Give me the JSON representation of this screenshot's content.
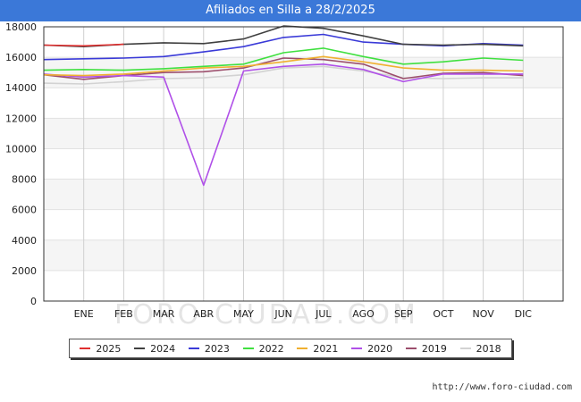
{
  "page": {
    "title": "Afiliados en Silla a 28/2/2025",
    "url": "http://www.foro-ciudad.com",
    "watermark": "FORO-CIUDAD.COM"
  },
  "chart_data": {
    "type": "line",
    "title": "Afiliados en Silla a 28/2/2025",
    "categories": [
      "",
      "ENE",
      "FEB",
      "MAR",
      "ABR",
      "MAY",
      "JUN",
      "JUL",
      "AGO",
      "SEP",
      "OCT",
      "NOV",
      "DIC"
    ],
    "ylim": [
      0,
      18000
    ],
    "yticks": [
      0,
      2000,
      4000,
      6000,
      8000,
      10000,
      12000,
      14000,
      16000,
      18000
    ],
    "grid": true,
    "legend_position": "bottom",
    "series": [
      {
        "name": "2025",
        "color": "#e03030",
        "values": [
          16800,
          16750,
          16850
        ]
      },
      {
        "name": "2024",
        "color": "#404040",
        "values": [
          16800,
          16700,
          16850,
          16950,
          16900,
          17200,
          18050,
          17900,
          17400,
          16850,
          16800,
          16850,
          16750
        ]
      },
      {
        "name": "2023",
        "color": "#3a3ad8",
        "values": [
          15850,
          15900,
          15950,
          16050,
          16350,
          16700,
          17300,
          17500,
          17000,
          16850,
          16750,
          16900,
          16800
        ]
      },
      {
        "name": "2022",
        "color": "#40e040",
        "values": [
          15150,
          15200,
          15150,
          15250,
          15400,
          15550,
          16300,
          16600,
          16050,
          15550,
          15700,
          15950,
          15800
        ]
      },
      {
        "name": "2021",
        "color": "#f0b030",
        "values": [
          14850,
          14800,
          14900,
          15100,
          15300,
          15400,
          15700,
          16050,
          15700,
          15300,
          15150,
          15150,
          15100
        ]
      },
      {
        "name": "2020",
        "color": "#b050e8",
        "values": [
          14900,
          14700,
          14800,
          14700,
          7600,
          15100,
          15400,
          15550,
          15200,
          14400,
          14900,
          14900,
          14900
        ]
      },
      {
        "name": "2019",
        "color": "#9c4e6c",
        "values": [
          14850,
          14550,
          14800,
          15000,
          15050,
          15300,
          15950,
          15850,
          15550,
          14600,
          14950,
          15000,
          14800
        ]
      },
      {
        "name": "2018",
        "color": "#d2d2d2",
        "values": [
          14300,
          14250,
          14400,
          14600,
          14650,
          14850,
          15300,
          15400,
          15100,
          14650,
          14600,
          14650,
          14650
        ]
      }
    ]
  }
}
